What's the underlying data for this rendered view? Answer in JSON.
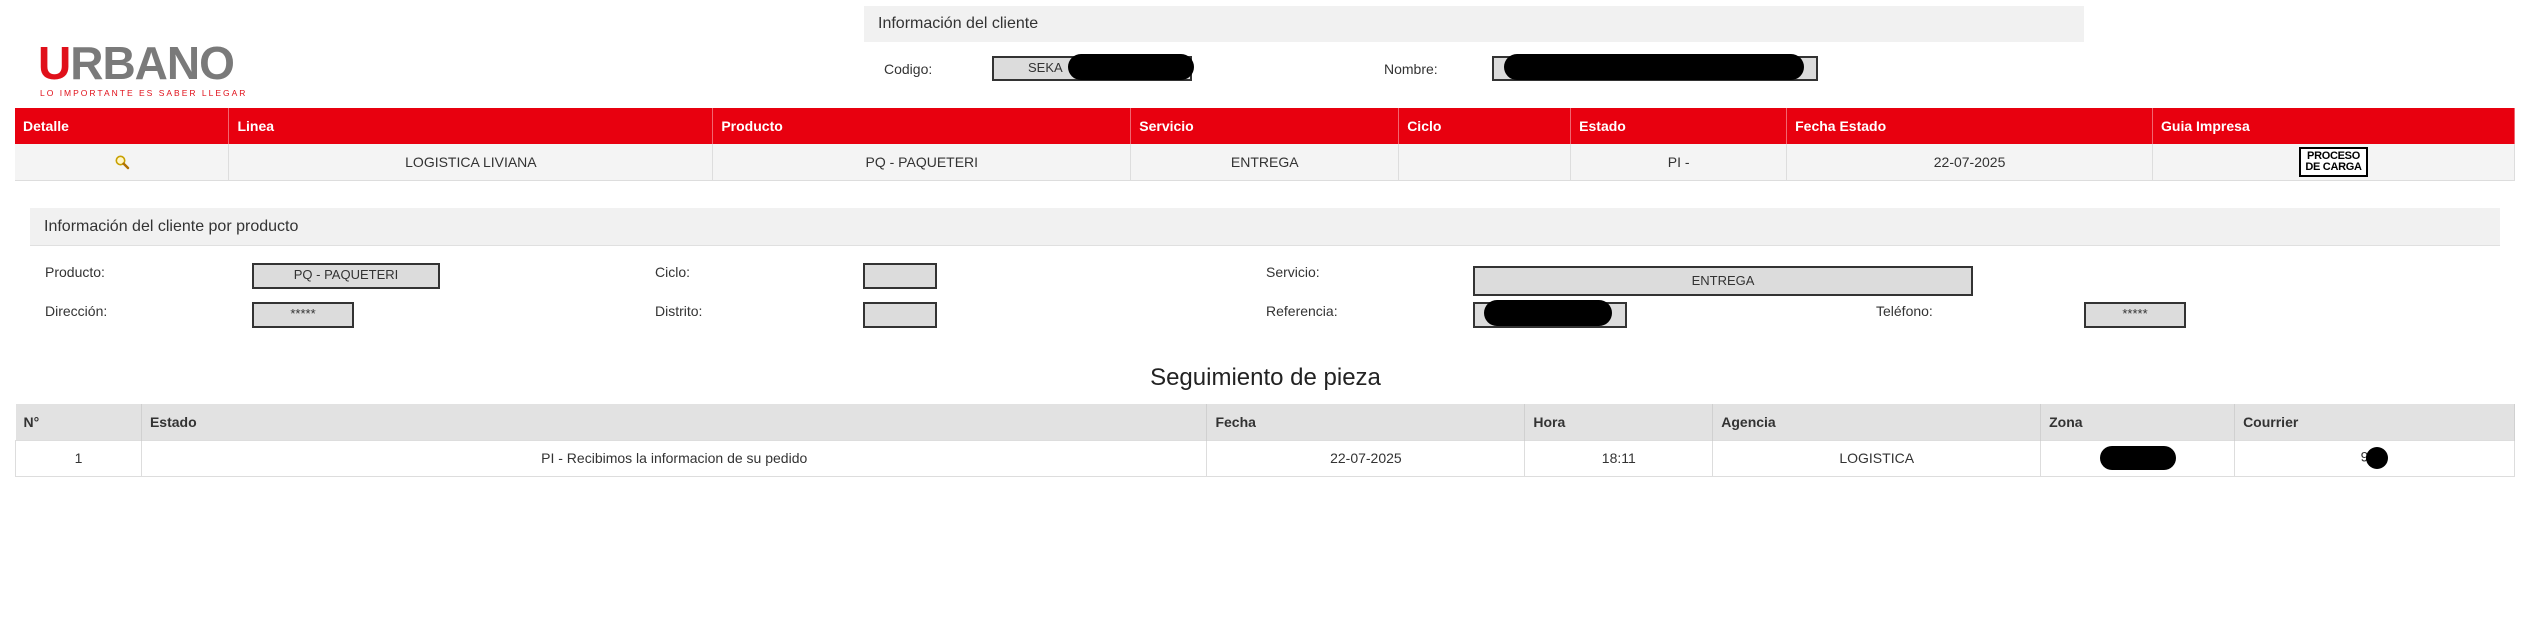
{
  "logo": {
    "first_letter": "U",
    "rest": "RBANO",
    "tagline": "LO IMPORTANTE ES SABER LLEGAR"
  },
  "client": {
    "title": "Información del cliente",
    "codigo_label": "Codigo:",
    "codigo_value": "SEKA",
    "nombre_label": "Nombre:"
  },
  "main_table": {
    "headers": [
      "Detalle",
      "Linea",
      "Producto",
      "Servicio",
      "Ciclo",
      "Estado",
      "Fecha Estado",
      "Guia Impresa"
    ],
    "row": {
      "linea": "LOGISTICA LIVIANA",
      "producto": "PQ - PAQUETERI",
      "servicio": "ENTREGA",
      "ciclo": "",
      "estado": "PI -",
      "fecha_estado": "22-07-2025",
      "guia_line1": "PROCESO",
      "guia_line2": "DE CARGA"
    }
  },
  "product_info": {
    "title": "Información del cliente por producto",
    "producto_label": "Producto:",
    "producto_value": "PQ - PAQUETERI",
    "ciclo_label": "Ciclo:",
    "ciclo_value": "",
    "servicio_label": "Servicio:",
    "servicio_value": "ENTREGA",
    "direccion_label": "Dirección:",
    "direccion_value": "*****",
    "distrito_label": "Distrito:",
    "distrito_value": "",
    "referencia_label": "Referencia:",
    "telefono_label": "Teléfono:",
    "telefono_value": "*****"
  },
  "tracking": {
    "title": "Seguimiento de pieza",
    "headers": [
      "N°",
      "Estado",
      "Fecha",
      "Hora",
      "Agencia",
      "Zona",
      "Courrier"
    ],
    "row": {
      "n": "1",
      "estado": "PI - Recibimos la informacion de su pedido",
      "fecha": "22-07-2025",
      "hora": "18:11",
      "agencia": "LOGISTICA",
      "courrier": "9"
    }
  },
  "colors": {
    "brand_red": "#e8000f",
    "logo_grey": "#7a7a7a"
  }
}
